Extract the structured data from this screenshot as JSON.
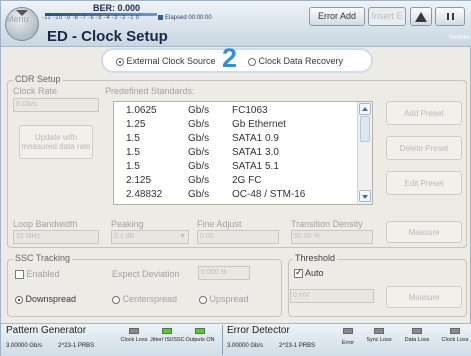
{
  "header": {
    "menu_label": "Menu",
    "ber_label": "BER: 0.000",
    "ber_scale": "-11 -10 -9 -8 -7 -6 -5 -4 -3 -2 -1 0",
    "elapsed": "Elapsed 00:00:00",
    "title": "ED - Clock Setup",
    "error_add_label": "Error Add",
    "insert_label": "Insert E",
    "remote_label": "Remote"
  },
  "clock_source": {
    "external_label": "External Clock Source",
    "cdr_label": "Clock Data Recovery",
    "selected": "external",
    "callout": "2"
  },
  "cdr_setup": {
    "title": "CDR Setup",
    "clock_rate_label": "Clock Rate",
    "clock_rate_value": "8 Gb/s",
    "update_button_label": "Update with measured data rate",
    "predefined_label": "Predefined Standards:",
    "standards": [
      {
        "rate": "1.0625",
        "unit": "Gb/s",
        "name": "FC1063"
      },
      {
        "rate": "1.25",
        "unit": "Gb/s",
        "name": "Gb Ethernet"
      },
      {
        "rate": "1.5",
        "unit": "Gb/s",
        "name": "SATA1 0.9"
      },
      {
        "rate": "1.5",
        "unit": "Gb/s",
        "name": "SATA1 3.0"
      },
      {
        "rate": "1.5",
        "unit": "Gb/s",
        "name": "SATA1 5.1"
      },
      {
        "rate": "2.125",
        "unit": "Gb/s",
        "name": "2G FC"
      },
      {
        "rate": "2.48832",
        "unit": "Gb/s",
        "name": "OC-48 / STM-16"
      }
    ],
    "add_preset_label": "Add Preset",
    "delete_preset_label": "Delete Preset",
    "edit_preset_label": "Edit Preset",
    "loop_bandwidth_label": "Loop Bandwidth",
    "loop_bandwidth_value": "10 MHz",
    "peaking_label": "Peaking",
    "peaking_value": "0.1 dB",
    "fine_adjust_label": "Fine Adjust",
    "fine_adjust_value": "0.00",
    "transition_density_label": "Transition Density",
    "transition_density_value": "50.00 %",
    "measure_label": "Measure"
  },
  "ssc": {
    "title": "SSC Tracking",
    "enabled_label": "Enabled",
    "expect_deviation_label": "Expect Deviation",
    "expect_deviation_value": "0.000 %",
    "downspread_label": "Downspread",
    "centerspread_label": "Centerspread",
    "upspread_label": "Upspread"
  },
  "threshold": {
    "title": "Threshold",
    "auto_label": "Auto",
    "value": "0 mV",
    "measure_label": "Measure"
  },
  "status": {
    "pg_title": "Pattern Generator",
    "pg_rate": "3.00000 Gb/s",
    "pg_pattern": "2^23-1 PRBS",
    "pg_leds": [
      {
        "label": "Clock Loss",
        "state": "off"
      },
      {
        "label": "Jitter/ ISI/SSC",
        "state": "on"
      },
      {
        "label": "Outputs ON",
        "state": "on"
      }
    ],
    "ed_title": "Error Detector",
    "ed_rate": "3.00000 Gb/s",
    "ed_pattern": "2^23-1 PRBS",
    "ed_leds": [
      {
        "label": "Error",
        "state": "off"
      },
      {
        "label": "Sync Loss",
        "state": "off"
      },
      {
        "label": "Data Loss",
        "state": "off"
      },
      {
        "label": "Clock Loss",
        "state": "off"
      }
    ]
  },
  "colors": {
    "accent": "#2f8fd8",
    "led_on": "#56c63d",
    "led_off": "#8a8a8a"
  }
}
